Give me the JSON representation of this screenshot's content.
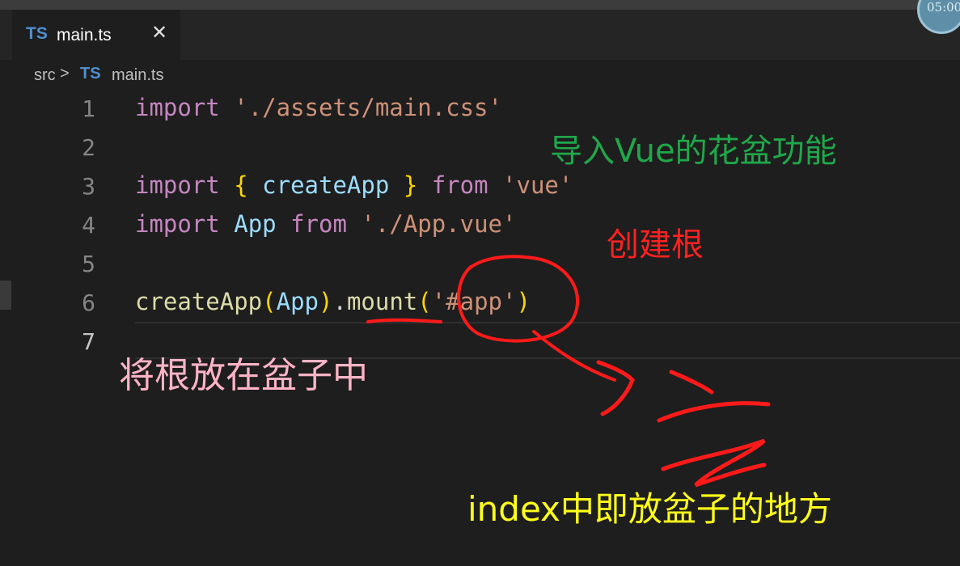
{
  "editor": {
    "tab": {
      "lang_badge": "TS",
      "filename": "main.ts",
      "close_glyph": "✕"
    },
    "breadcrumb": {
      "folder": "src",
      "separator": ">",
      "lang_badge": "TS",
      "filename": "main.ts"
    },
    "timer": "05:00",
    "lines": [
      {
        "number": "1",
        "tokens": [
          [
            "kw",
            "import"
          ],
          [
            "plain",
            " "
          ],
          [
            "str",
            "'./assets/main.css'"
          ]
        ]
      },
      {
        "number": "2",
        "tokens": []
      },
      {
        "number": "3",
        "tokens": [
          [
            "kw",
            "import"
          ],
          [
            "plain",
            " "
          ],
          [
            "brace",
            "{"
          ],
          [
            "plain",
            " "
          ],
          [
            "ident",
            "createApp"
          ],
          [
            "plain",
            " "
          ],
          [
            "brace",
            "}"
          ],
          [
            "plain",
            " "
          ],
          [
            "kw",
            "from"
          ],
          [
            "plain",
            " "
          ],
          [
            "str",
            "'vue'"
          ]
        ]
      },
      {
        "number": "4",
        "tokens": [
          [
            "kw",
            "import"
          ],
          [
            "plain",
            " "
          ],
          [
            "ident",
            "App"
          ],
          [
            "plain",
            " "
          ],
          [
            "kw",
            "from"
          ],
          [
            "plain",
            " "
          ],
          [
            "str",
            "'./App.vue'"
          ]
        ]
      },
      {
        "number": "5",
        "tokens": []
      },
      {
        "number": "6",
        "tokens": [
          [
            "fn",
            "createApp"
          ],
          [
            "paren",
            "("
          ],
          [
            "ident",
            "App"
          ],
          [
            "paren",
            ")"
          ],
          [
            "plain",
            "."
          ],
          [
            "fn",
            "mount"
          ],
          [
            "paren",
            "("
          ],
          [
            "str",
            "'#app'"
          ],
          [
            "paren",
            ")"
          ]
        ]
      },
      {
        "number": "7",
        "tokens": []
      }
    ],
    "active_line": "7"
  },
  "annotations": {
    "import_vue": "导入Vue的花盆功能",
    "create_root": "创建根",
    "mount_root": "将根放在盆子中",
    "index_pot": "index中即放盆子的地方"
  },
  "colors": {
    "green_note": "#1fa84a",
    "red_note": "#ff2020",
    "pink_note": "#ffb3c6",
    "yellow_note": "#ffff1a"
  }
}
